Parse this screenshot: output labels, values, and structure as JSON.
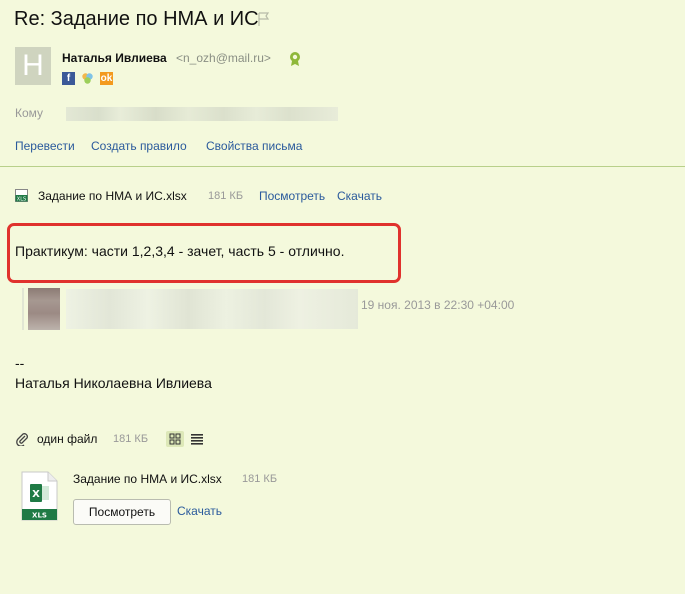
{
  "message": {
    "subject": "Re: Задание по НМА и ИС"
  },
  "sender": {
    "avatar_letter": "Н",
    "name": "Наталья Ивлиева",
    "email": "<n_ozh@mail.ru>",
    "social": [
      "facebook-icon",
      "moikrug-icon",
      "odnoklassniki-icon"
    ]
  },
  "recipients": {
    "label": "Кому"
  },
  "actions": {
    "translate": "Перевести",
    "create_rule": "Создать правило",
    "properties": "Свойства письма"
  },
  "top_attachment": {
    "name": "Задание по НМА и ИС.xlsx",
    "size": "181 КБ",
    "view": "Посмотреть",
    "download": "Скачать"
  },
  "body": {
    "text": "Практикум: части 1,2,3,4 - зачет, часть 5 - отлично."
  },
  "quote": {
    "date": "19 ноя. 2013 в 22:30 +04:00"
  },
  "signature": {
    "dash": "--",
    "name": "Наталья Николаевна Ивлиева"
  },
  "attachments": {
    "count_label": "один файл",
    "total_size": "181 КБ",
    "file": {
      "name": "Задание по НМА и ИС.xlsx",
      "size": "181 КБ",
      "type_label": "XLS"
    },
    "view_button": "Посмотреть",
    "download_link": "Скачать"
  },
  "colors": {
    "background": "#f4f9dc",
    "link": "#2a5a9c",
    "highlight": "#e0322d",
    "excel": "#1f7a45"
  }
}
